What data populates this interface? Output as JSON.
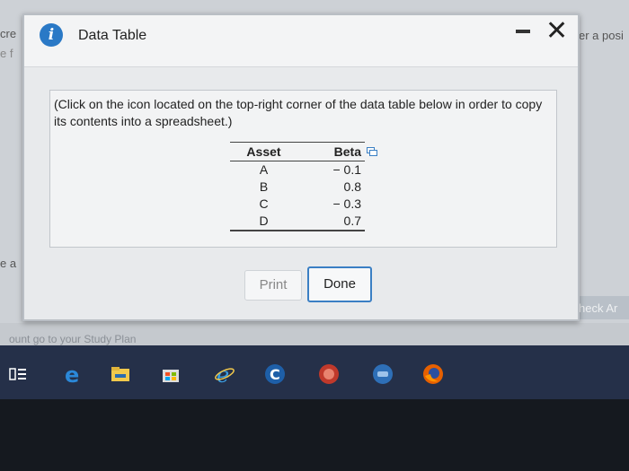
{
  "background": {
    "fragments": {
      "cre": "cre",
      "ef": "e f",
      "ea": "e a",
      "posi": "er a posi",
      "bottom": "ount go to your Study Plan"
    },
    "check_button_label": "heck Ar"
  },
  "dialog": {
    "title": "Data Table",
    "info_icon": "info-icon",
    "instruction": "(Click on the icon located on the top-right corner of the data table below in order to copy its contents into a spreadsheet.)",
    "table": {
      "headers": [
        "Asset",
        "Beta"
      ],
      "rows": [
        [
          "A",
          "− 0.1"
        ],
        [
          "B",
          "0.8"
        ],
        [
          "C",
          "− 0.3"
        ],
        [
          "D",
          "0.7"
        ]
      ]
    },
    "print_label": "Print",
    "done_label": "Done",
    "colors": {
      "accent": "#3a7fc4",
      "info": "#2a79c6"
    }
  },
  "taskbar": {
    "icons": [
      "task-view-icon",
      "edge-icon",
      "file-explorer-icon",
      "store-icon",
      "ie-icon",
      "app-c-icon",
      "app-red-icon",
      "app-blue-icon",
      "firefox-icon"
    ]
  }
}
